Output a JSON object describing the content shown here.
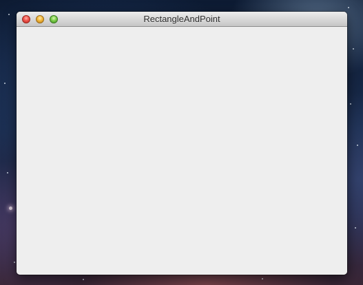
{
  "window": {
    "title": "RectangleAndPoint"
  },
  "icons": {
    "close": "close-button-icon",
    "minimize": "minimize-button-icon",
    "zoom": "zoom-button-icon"
  },
  "colors": {
    "content_background": "#eeeeee",
    "close": "#f0544c",
    "minimize": "#f2b73a",
    "zoom": "#7ccc4a"
  }
}
